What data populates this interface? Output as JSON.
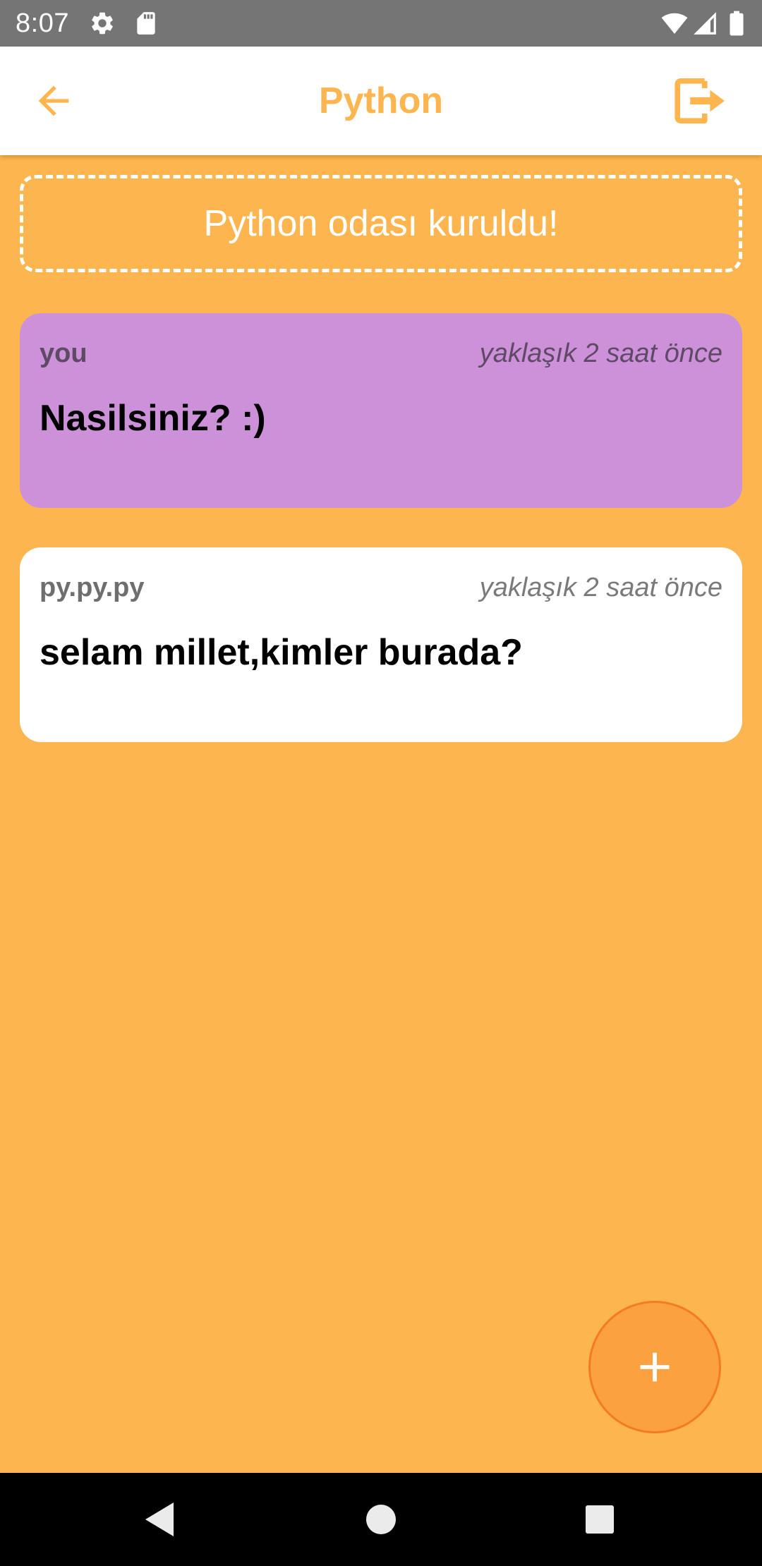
{
  "status_bar": {
    "time": "8:07",
    "icons": [
      "gear-icon",
      "sd-card-icon",
      "wifi-icon",
      "signal-icon",
      "battery-icon"
    ]
  },
  "app_bar": {
    "title": "Python",
    "back_icon": "arrow-left-icon",
    "exit_icon": "exit-icon"
  },
  "banner": {
    "text": "Python odası kuruldu!"
  },
  "messages": [
    {
      "sender": "you",
      "time": "yaklaşık 2 saat önce",
      "text": "Nasilsiniz? :)",
      "own": true
    },
    {
      "sender": "py.py.py",
      "time": "yaklaşık 2 saat önce",
      "text": "selam millet,kimler burada?",
      "own": false
    }
  ],
  "fab": {
    "icon": "plus-icon"
  },
  "nav_bar": {
    "icons": [
      "back-triangle-icon",
      "home-circle-icon",
      "recents-square-icon"
    ]
  },
  "colors": {
    "accent": "#FDB64F",
    "own_message": "#CD91DA",
    "other_message": "#FFFFFF",
    "fab": "#FBA140"
  }
}
